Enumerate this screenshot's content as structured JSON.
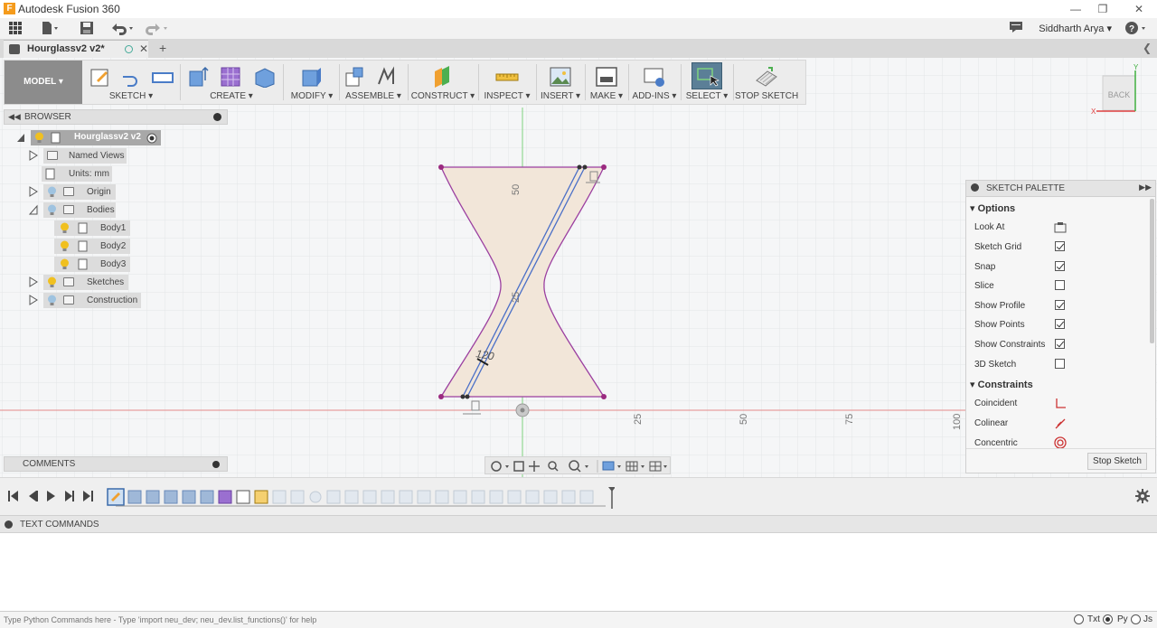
{
  "window": {
    "title": "Autodesk Fusion 360",
    "logo_letter": "F"
  },
  "appbar": {
    "user": "Siddharth Arya ▾",
    "help": "?"
  },
  "tab": {
    "name": "Hourglassv2 v2*"
  },
  "toolbar": {
    "model": "MODEL ▾",
    "groups": [
      {
        "label": "SKETCH ▾"
      },
      {
        "label": "CREATE ▾"
      },
      {
        "label": "MODIFY ▾"
      },
      {
        "label": "ASSEMBLE ▾"
      },
      {
        "label": "CONSTRUCT ▾"
      },
      {
        "label": "INSPECT ▾"
      },
      {
        "label": "INSERT ▾"
      },
      {
        "label": "MAKE ▾"
      },
      {
        "label": "ADD-INS ▾"
      },
      {
        "label": "SELECT ▾"
      },
      {
        "label": "STOP SKETCH"
      }
    ]
  },
  "browser": {
    "title": "BROWSER",
    "root": "Hourglassv2 v2",
    "items": [
      {
        "label": "Named Views"
      },
      {
        "label": "Units: mm"
      },
      {
        "label": "Origin"
      },
      {
        "label": "Bodies"
      },
      {
        "label": "Body1"
      },
      {
        "label": "Body2"
      },
      {
        "label": "Body3"
      },
      {
        "label": "Sketches"
      },
      {
        "label": "Construction"
      }
    ]
  },
  "comments": {
    "title": "COMMENTS"
  },
  "viewcube": {
    "label": "BACK",
    "x_axis": "X",
    "y_axis": "Y"
  },
  "sketch": {
    "dims": {
      "top": "50",
      "middle": "25",
      "diag": "120"
    },
    "axis_ticks": [
      "25",
      "50",
      "75",
      "100"
    ],
    "colors": {
      "profile_fill": "#f0e6da",
      "profile_stroke": "#9b3fa0",
      "line": "#4a6fc7",
      "axis_green": "#6ecf6e",
      "axis_red": "#e07070"
    }
  },
  "palette": {
    "title": "SKETCH PALETTE",
    "options_title": "Options",
    "options": [
      {
        "label": "Look At",
        "type": "icon"
      },
      {
        "label": "Sketch Grid",
        "checked": true
      },
      {
        "label": "Snap",
        "checked": true
      },
      {
        "label": "Slice",
        "checked": false
      },
      {
        "label": "Show Profile",
        "checked": true
      },
      {
        "label": "Show Points",
        "checked": true
      },
      {
        "label": "Show Constraints",
        "checked": true
      },
      {
        "label": "3D Sketch",
        "checked": false
      }
    ],
    "constraints_title": "Constraints",
    "constraints": [
      {
        "label": "Coincident"
      },
      {
        "label": "Colinear"
      },
      {
        "label": "Concentric"
      }
    ],
    "stop_button": "Stop Sketch"
  },
  "textcommands": {
    "title": "TEXT COMMANDS",
    "prompt": "Type Python Commands here - Type 'import neu_dev; neu_dev.list_functions()' for help",
    "modes": [
      "Txt",
      "Py",
      "Js"
    ]
  }
}
